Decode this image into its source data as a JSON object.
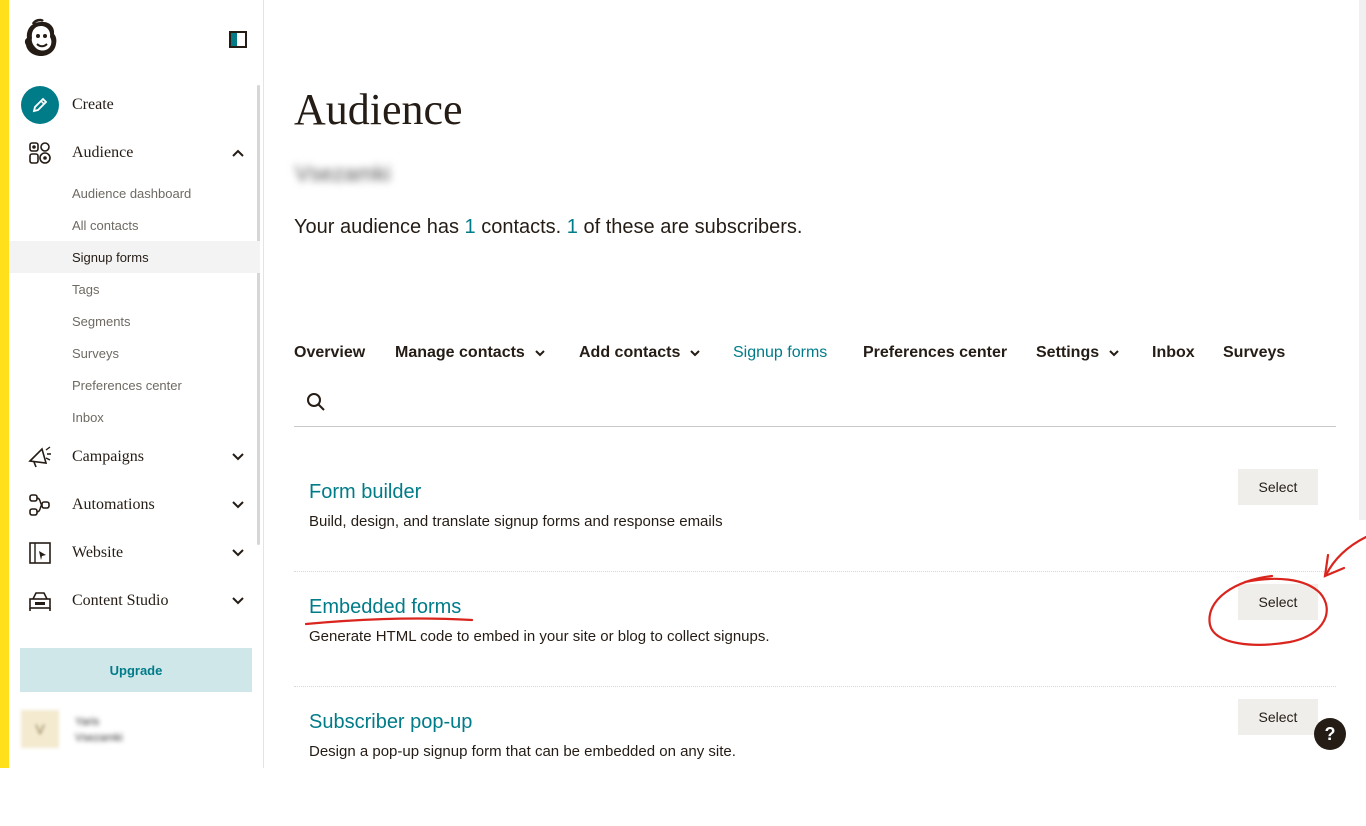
{
  "sidebar": {
    "create_label": "Create",
    "audience_label": "Audience",
    "audience_items": [
      {
        "label": "Audience dashboard"
      },
      {
        "label": "All contacts"
      },
      {
        "label": "Signup forms"
      },
      {
        "label": "Tags"
      },
      {
        "label": "Segments"
      },
      {
        "label": "Surveys"
      },
      {
        "label": "Preferences center"
      },
      {
        "label": "Inbox"
      }
    ],
    "active_item": "Signup forms",
    "sections": [
      {
        "label": "Campaigns",
        "icon": "megaphone-icon"
      },
      {
        "label": "Automations",
        "icon": "flow-icon"
      },
      {
        "label": "Website",
        "icon": "website-icon"
      },
      {
        "label": "Content Studio",
        "icon": "content-studio-icon"
      }
    ],
    "upgrade_label": "Upgrade",
    "account": {
      "avatar_letter": "V",
      "name": "Yaris",
      "org": "Vsezamki"
    }
  },
  "main": {
    "title": "Audience",
    "audience_name": "Vsezamki",
    "summary": {
      "pre": "Your audience has ",
      "contacts": "1",
      "mid": " contacts. ",
      "subscribers": "1",
      "post": " of these are subscribers."
    },
    "tabs": [
      {
        "label": "Overview"
      },
      {
        "label": "Manage contacts"
      },
      {
        "label": "Add contacts"
      },
      {
        "label": "Signup forms"
      },
      {
        "label": "Preferences center"
      },
      {
        "label": "Settings"
      },
      {
        "label": "Inbox"
      },
      {
        "label": "Surveys"
      }
    ],
    "active_tab": "Signup forms",
    "options": [
      {
        "title": "Form builder",
        "desc": "Build, design, and translate signup forms and response emails",
        "button": "Select"
      },
      {
        "title": "Embedded forms",
        "desc": "Generate HTML code to embed in your site or blog to collect signups.",
        "button": "Select"
      },
      {
        "title": "Subscriber pop-up",
        "desc": "Design a pop-up signup form that can be embedded on any site.",
        "button": "Select"
      }
    ]
  },
  "help_label": "?",
  "colors": {
    "accent": "#007c89",
    "brand_yellow": "#ffe01b",
    "annotation": "#d9251d",
    "text": "#241c15"
  }
}
